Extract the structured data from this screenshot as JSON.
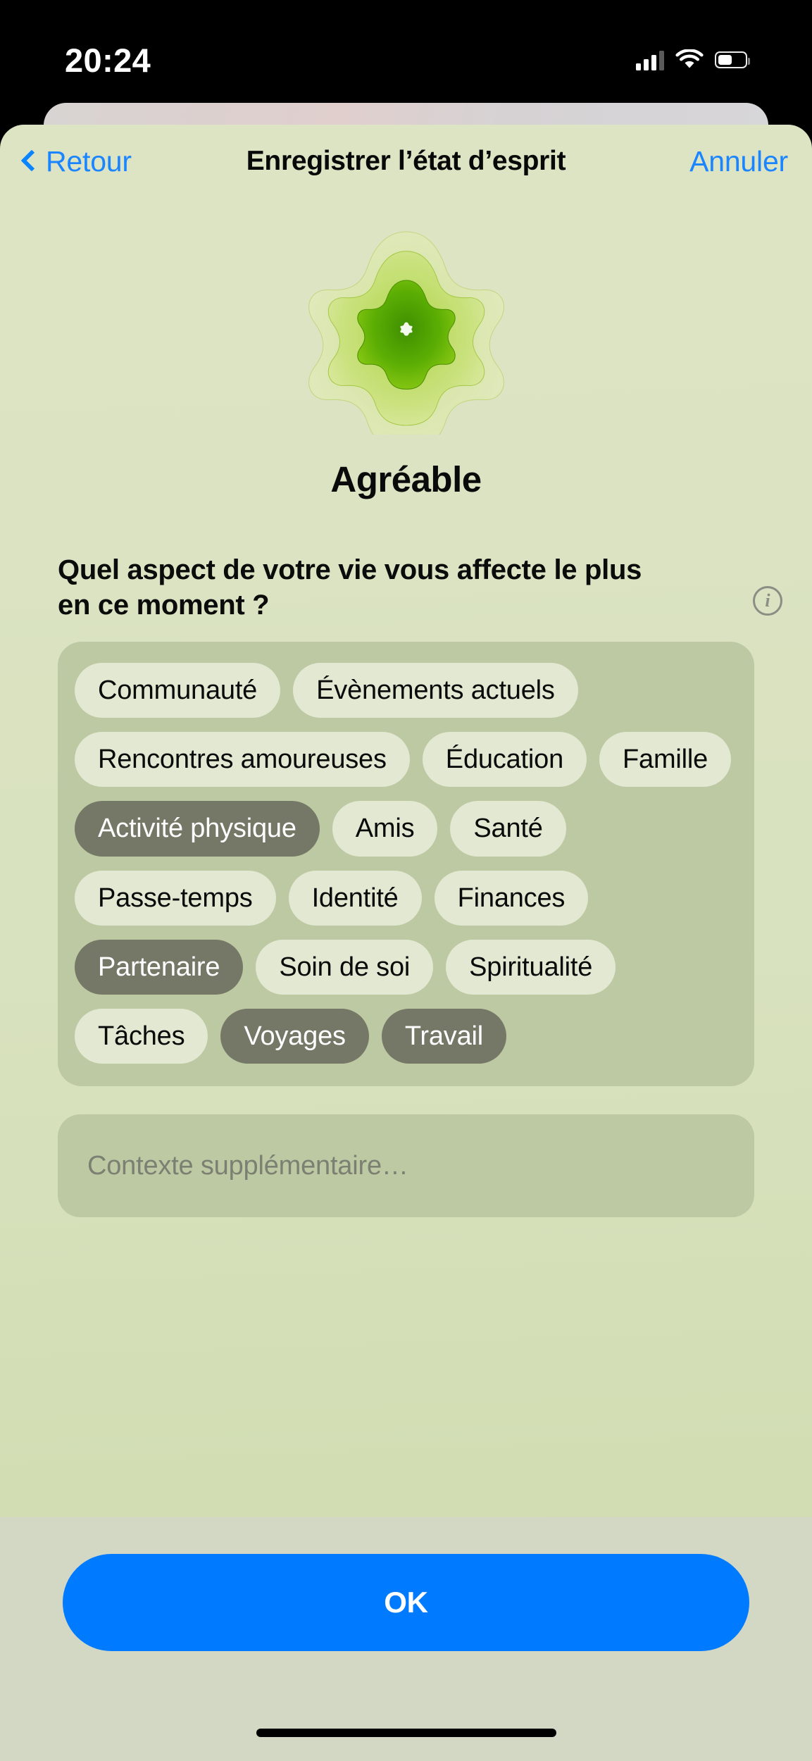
{
  "status_bar": {
    "time": "20:24",
    "cellular_icon": "cellular-signal-icon",
    "wifi_icon": "wifi-icon",
    "battery_icon": "battery-icon"
  },
  "nav": {
    "back_label": "Retour",
    "back_icon": "chevron-left-icon",
    "title": "Enregistrer l’état d’esprit",
    "cancel_label": "Annuler"
  },
  "mood": {
    "graphic_icon": "mood-flower-icon",
    "label": "Agréable",
    "petal_colors": {
      "outer": "#d3e48c",
      "middle": "#b8dc52",
      "inner": "#5ea800",
      "center": "#ffffff"
    }
  },
  "question": {
    "text": "Quel aspect de votre vie vous affecte le plus en ce moment ?",
    "info_icon": "info-circle-icon",
    "info_glyph": "i"
  },
  "chips": {
    "unselected_bg": "#e2e8d1",
    "selected_bg": "#767867",
    "container_bg": "#bdc9a2",
    "items": [
      {
        "label": "Communauté",
        "selected": false
      },
      {
        "label": "Évènements actuels",
        "selected": false
      },
      {
        "label": "Rencontres amoureuses",
        "selected": false
      },
      {
        "label": "Éducation",
        "selected": false
      },
      {
        "label": "Famille",
        "selected": false
      },
      {
        "label": "Activité physique",
        "selected": true
      },
      {
        "label": "Amis",
        "selected": false
      },
      {
        "label": "Santé",
        "selected": false
      },
      {
        "label": "Passe-temps",
        "selected": false
      },
      {
        "label": "Identité",
        "selected": false
      },
      {
        "label": "Finances",
        "selected": false
      },
      {
        "label": "Partenaire",
        "selected": true
      },
      {
        "label": "Soin de soi",
        "selected": false
      },
      {
        "label": "Spiritualité",
        "selected": false
      },
      {
        "label": "Tâches",
        "selected": false
      },
      {
        "label": "Voyages",
        "selected": true
      },
      {
        "label": "Travail",
        "selected": true
      }
    ]
  },
  "note": {
    "placeholder": "Contexte supplémentaire…",
    "value": ""
  },
  "footer": {
    "ok_label": "OK",
    "ok_color": "#007aff"
  }
}
